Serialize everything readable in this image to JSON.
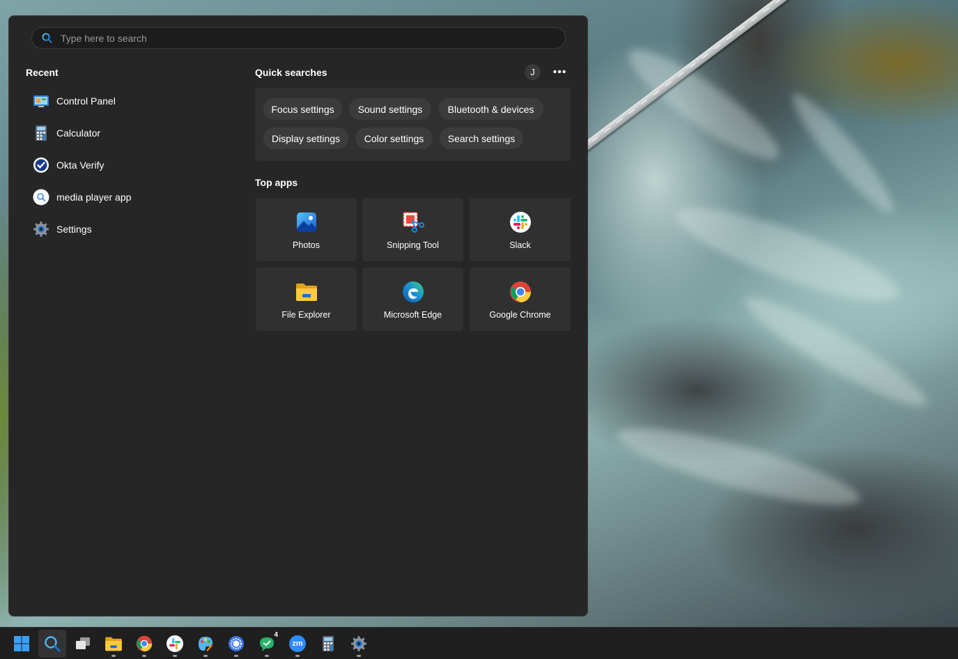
{
  "search": {
    "placeholder": "Type here to search"
  },
  "recent": {
    "heading": "Recent",
    "items": [
      {
        "label": "Control Panel",
        "icon": "control-panel-icon"
      },
      {
        "label": "Calculator",
        "icon": "calculator-icon"
      },
      {
        "label": "Okta Verify",
        "icon": "okta-verify-icon"
      },
      {
        "label": "media player app",
        "icon": "search-result-icon"
      },
      {
        "label": "Settings",
        "icon": "settings-gear-icon"
      }
    ]
  },
  "quick_searches": {
    "heading": "Quick searches",
    "avatar_initial": "J",
    "more_label": "•••",
    "chips": [
      "Focus settings",
      "Sound settings",
      "Bluetooth & devices",
      "Display settings",
      "Color settings",
      "Search settings"
    ]
  },
  "top_apps": {
    "heading": "Top apps",
    "apps": [
      {
        "label": "Photos",
        "icon": "photos-icon"
      },
      {
        "label": "Snipping Tool",
        "icon": "snipping-tool-icon"
      },
      {
        "label": "Slack",
        "icon": "slack-icon"
      },
      {
        "label": "File Explorer",
        "icon": "file-explorer-icon"
      },
      {
        "label": "Microsoft Edge",
        "icon": "edge-icon"
      },
      {
        "label": "Google Chrome",
        "icon": "chrome-icon"
      }
    ]
  },
  "taskbar": {
    "items": [
      {
        "name": "start-button",
        "icon": "windows-logo-icon"
      },
      {
        "name": "search-button",
        "icon": "search-icon"
      },
      {
        "name": "task-view-button",
        "icon": "task-view-icon"
      },
      {
        "name": "file-explorer",
        "icon": "folder-icon"
      },
      {
        "name": "chrome",
        "icon": "chrome-icon"
      },
      {
        "name": "slack",
        "icon": "slack-icon"
      },
      {
        "name": "paint",
        "icon": "paint-palette-icon"
      },
      {
        "name": "signal",
        "icon": "signal-icon"
      },
      {
        "name": "chat",
        "icon": "chat-bubble-icon",
        "badge": "4"
      },
      {
        "name": "zoom",
        "icon": "zoom-icon",
        "text": "zm"
      },
      {
        "name": "calculator",
        "icon": "calculator-icon"
      },
      {
        "name": "settings",
        "icon": "settings-gear-icon"
      }
    ]
  }
}
